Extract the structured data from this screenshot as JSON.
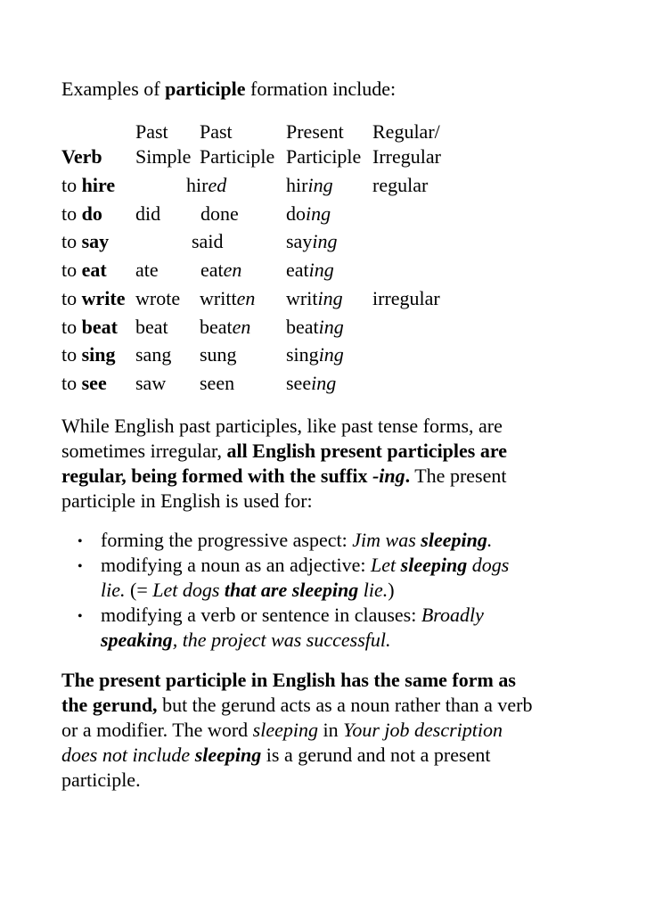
{
  "intro": {
    "prefix": "Examples of ",
    "bold": "participle",
    "suffix": " formation include:"
  },
  "table": {
    "headers": {
      "verb": "Verb",
      "past_simple": [
        "Past",
        "Simple"
      ],
      "past_participle": [
        "Past",
        "Participle"
      ],
      "present_participle": [
        "Present",
        "Participle"
      ],
      "regularity": [
        "Regular/",
        "Irregular"
      ]
    },
    "rows": [
      {
        "to": "to ",
        "verb": "hire",
        "past_simple": "",
        "past_participle_stem": "hir",
        "past_participle_suffix": "ed",
        "shared_past": true,
        "present_stem": "hir",
        "present_suffix": "ing",
        "regularity": "regular"
      },
      {
        "to": "to ",
        "verb": "do",
        "past_simple": "did",
        "past_participle_stem": "done",
        "past_participle_suffix": "",
        "shared_past": false,
        "present_stem": "do",
        "present_suffix": "ing",
        "regularity": ""
      },
      {
        "to": "to ",
        "verb": "say",
        "past_simple": "",
        "past_participle_stem": "said",
        "past_participle_suffix": "",
        "shared_past": true,
        "present_stem": "say",
        "present_suffix": "ing",
        "regularity": ""
      },
      {
        "to": "to ",
        "verb": "eat",
        "past_simple": "ate",
        "past_participle_stem": "eat",
        "past_participle_suffix": "en",
        "shared_past": false,
        "present_stem": "eat",
        "present_suffix": "ing",
        "regularity": ""
      },
      {
        "to": "to ",
        "verb": "write",
        "past_simple": "wrote",
        "past_participle_stem": "writt",
        "past_participle_suffix": "en",
        "shared_past": false,
        "present_stem": "writ",
        "present_suffix": "ing",
        "regularity": "irregular"
      },
      {
        "to": "to ",
        "verb": "beat",
        "past_simple": "beat",
        "past_participle_stem": "beat",
        "past_participle_suffix": "en",
        "shared_past": false,
        "present_stem": "beat",
        "present_suffix": "ing",
        "regularity": ""
      },
      {
        "to": "to ",
        "verb": "sing",
        "past_simple": "sang",
        "past_participle_stem": "sung",
        "past_participle_suffix": "",
        "shared_past": false,
        "present_stem": "sing",
        "present_suffix": "ing",
        "regularity": ""
      },
      {
        "to": "to ",
        "verb": "see",
        "past_simple": "saw",
        "past_participle_stem": "seen",
        "past_participle_suffix": "",
        "shared_past": false,
        "present_stem": "see",
        "present_suffix": "ing",
        "regularity": ""
      }
    ]
  },
  "paragraph1": {
    "l1": "While English past participles, like past tense forms, are",
    "l2_plain": "sometimes irregular, ",
    "l2_bold": "all English present participles are",
    "l3_bold": "regular, being formed with the suffix ",
    "l3_bold_italic": "-ing",
    "l3_bold_end": ".",
    "l3_plain": " The present",
    "l4": "participle in English is used for:"
  },
  "bullets": {
    "marker": "•",
    "b1_plain": "forming the progressive aspect: ",
    "b1_italic": "Jim was ",
    "b1_bold_italic": "sleeping",
    "b1_end": ".",
    "b2_plain": "modifying a noun as an adjective: ",
    "b2_italic1": "Let ",
    "b2_bold_italic1": "sleeping",
    "b2_italic2": " dogs",
    "b2_l2_italic": "lie.",
    "b2_l2_plain1": " (= ",
    "b2_l2_italic2": "Let dogs ",
    "b2_l2_bold_italic": "that are sleeping",
    "b2_l2_italic3": " lie.",
    "b2_l2_plain2": ")",
    "b3_plain": "modifying a verb or sentence in clauses: ",
    "b3_italic": "Broadly",
    "b3_l2_bold_italic": "speaking",
    "b3_l2_italic": ", the project was successful."
  },
  "paragraph2": {
    "l1_bold": "The present participle in English has the same form as",
    "l2_bold": "the gerund,",
    "l2_plain": " but the gerund acts as a noun rather than a verb",
    "l3_plain": "or a modifier. The word ",
    "l3_italic1": "sleeping",
    "l3_plain2": " in ",
    "l3_italic2": "Your job description",
    "l4_italic": "does not include ",
    "l4_bold_italic": "sleeping",
    "l4_plain": " is a gerund and not a present",
    "l5": "participle."
  }
}
